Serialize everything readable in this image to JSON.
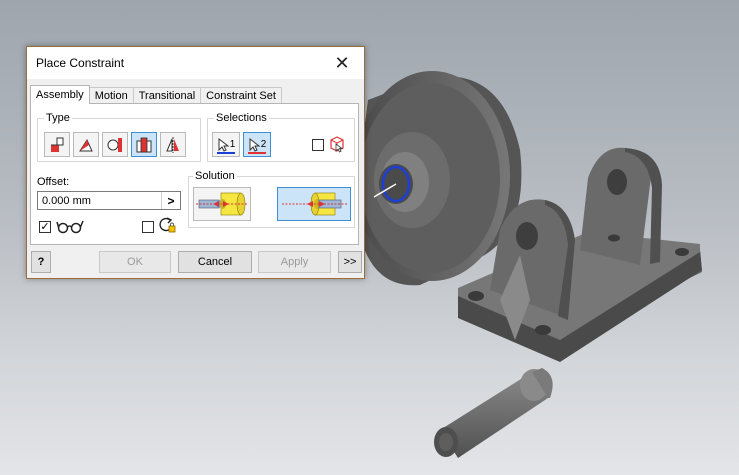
{
  "dialog": {
    "title": "Place Constraint",
    "close_glyph": "✕",
    "tabs": [
      {
        "label": "Assembly",
        "active": true
      },
      {
        "label": "Motion",
        "active": false
      },
      {
        "label": "Transitional",
        "active": false
      },
      {
        "label": "Constraint Set",
        "active": false
      }
    ],
    "type": {
      "label": "Type",
      "buttons": [
        "mate-icon",
        "angle-icon",
        "tangent-icon",
        "insert-icon",
        "symmetry-icon"
      ],
      "selected": "insert-icon"
    },
    "selections": {
      "label": "Selections",
      "select1_label": "1",
      "select2_label": "2",
      "active": 2,
      "pick_part_first_checked": false
    },
    "offset": {
      "label": "Offset:",
      "value": "0.000 mm",
      "arrow_glyph": ">"
    },
    "show_preview_checked": true,
    "predict_offset_checked": false,
    "solution": {
      "label": "Solution",
      "options": [
        "opposed-solution-icon",
        "aligned-solution-icon"
      ],
      "selected": "aligned-solution-icon"
    },
    "buttons": {
      "help": "?",
      "ok": "OK",
      "cancel": "Cancel",
      "apply": "Apply",
      "more": ">>"
    }
  },
  "colors": {
    "accent": "#3e8fd6",
    "selected_fill": "#cce4f7",
    "selection_highlight": "#1c3fd8",
    "model_gray": "#6e6e6e"
  }
}
